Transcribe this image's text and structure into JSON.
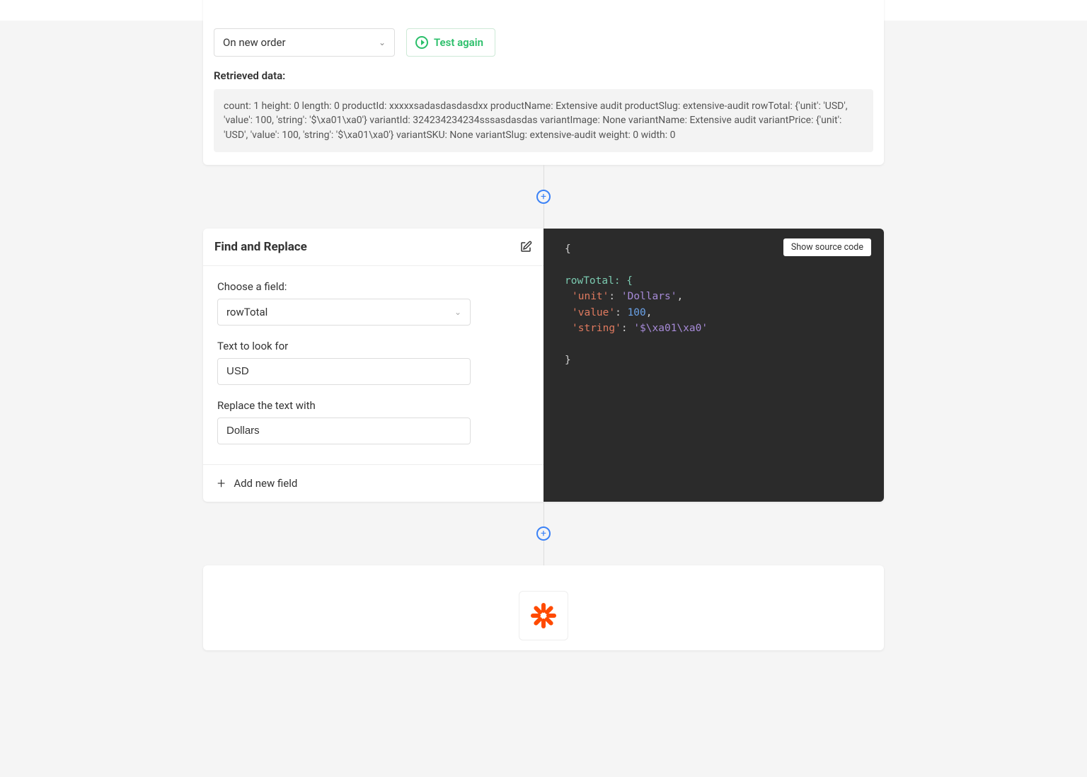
{
  "trigger": {
    "select_value": "On new order",
    "test_again_label": "Test again",
    "retrieved_label": "Retrieved data:",
    "retrieved_body": "count: 1 height: 0 length: 0 productId: xxxxxsadasdasdasdxx productName: Extensive audit productSlug: extensive-audit rowTotal: {'unit': 'USD', 'value': 100, 'string': '$\\xa01\\xa0'} variantId: 324234234234sssasdasdas variantImage: None variantName: Extensive audit variantPrice: {'unit': 'USD', 'value': 100, 'string': '$\\xa01\\xa0'} variantSKU: None variantSlug: extensive-audit weight: 0 width: 0"
  },
  "find_replace": {
    "title": "Find and Replace",
    "choose_field_label": "Choose a field:",
    "choose_field_value": "rowTotal",
    "look_for_label": "Text to look for",
    "look_for_value": "USD",
    "replace_label": "Replace the text with",
    "replace_value": "Dollars",
    "add_field_label": "Add new field",
    "source_btn_label": "Show source code",
    "code": {
      "open": "{",
      "field": "rowTotal: {",
      "unit_k": "'unit'",
      "unit_v": "'Dollars'",
      "value_k": "'value'",
      "value_v": "100",
      "string_k": "'string'",
      "string_v": "'$\\xa01\\xa0'",
      "close": "}"
    }
  }
}
